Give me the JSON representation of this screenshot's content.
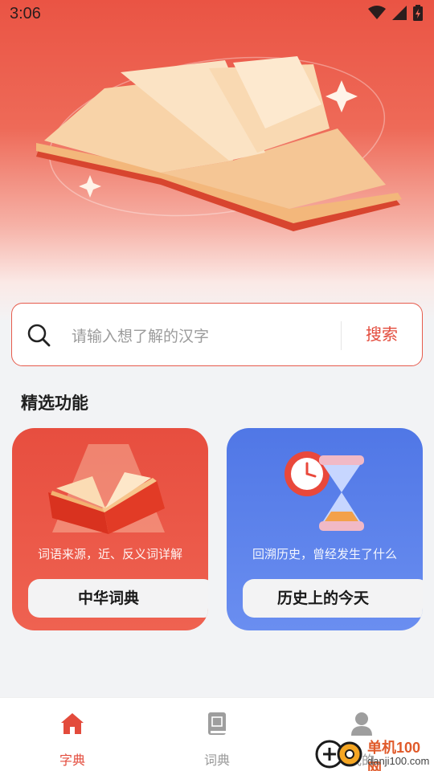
{
  "status_bar": {
    "time": "3:06"
  },
  "search": {
    "placeholder": "请输入想了解的汉字",
    "button_label": "搜索"
  },
  "featured": {
    "title": "精选功能",
    "cards": [
      {
        "description": "词语来源，近、反义词详解",
        "label": "中华词典",
        "color": "#e74e3f"
      },
      {
        "description": "回溯历史，曾经发生了什么",
        "label": "历史上的今天",
        "color": "#5077e6"
      }
    ]
  },
  "bottom_nav": {
    "items": [
      {
        "label": "字典",
        "icon": "home-icon",
        "active": true
      },
      {
        "label": "词典",
        "icon": "dictionary-icon",
        "active": false
      },
      {
        "label": "我的",
        "icon": "profile-icon",
        "active": false
      }
    ]
  },
  "watermark": {
    "brand": "单机100网",
    "domain": "danji100.com"
  },
  "colors": {
    "accent": "#e34b3c",
    "blue": "#5077e6",
    "background": "#f2f3f5"
  }
}
